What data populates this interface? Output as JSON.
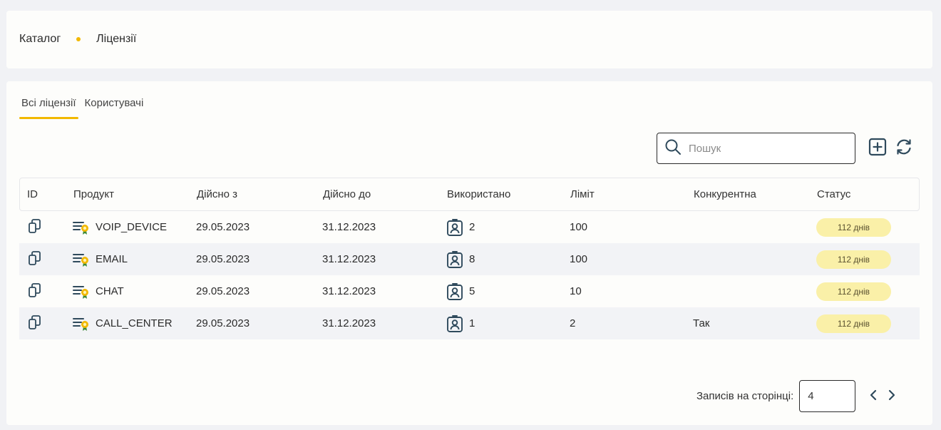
{
  "breadcrumb": {
    "root": "Каталог",
    "current": "Ліцензії"
  },
  "tabs": [
    {
      "label": "Всі ліцензії",
      "active": true
    },
    {
      "label": "Користувачі",
      "active": false
    }
  ],
  "search": {
    "placeholder": "Пошук",
    "value": ""
  },
  "table": {
    "headers": {
      "id": "ID",
      "product": "Продукт",
      "valid_from": "Дійсно з",
      "valid_to": "Дійсно до",
      "used": "Використано",
      "limit": "Ліміт",
      "concurrent": "Конкурентна",
      "status": "Статус"
    },
    "rows": [
      {
        "product": "VOIP_DEVICE",
        "valid_from": "29.05.2023",
        "valid_to": "31.12.2023",
        "used": "2",
        "limit": "100",
        "concurrent": "",
        "status": "112 днів"
      },
      {
        "product": "EMAIL",
        "valid_from": "29.05.2023",
        "valid_to": "31.12.2023",
        "used": "8",
        "limit": "100",
        "concurrent": "",
        "status": "112 днів"
      },
      {
        "product": "CHAT",
        "valid_from": "29.05.2023",
        "valid_to": "31.12.2023",
        "used": "5",
        "limit": "10",
        "concurrent": "",
        "status": "112 днів"
      },
      {
        "product": "CALL_CENTER",
        "valid_from": "29.05.2023",
        "valid_to": "31.12.2023",
        "used": "1",
        "limit": "2",
        "concurrent": "Так",
        "status": "112 днів"
      }
    ]
  },
  "pager": {
    "label": "Записів на сторінці:",
    "value": "4"
  },
  "colors": {
    "accent": "#f2b800",
    "badge_bg": "#faf0a8",
    "icon": "#2f4a5c"
  },
  "icons": {
    "copy": "copy-icon",
    "product": "license-list-icon",
    "used": "user-badge-icon",
    "search": "search-icon",
    "add": "add-square-icon",
    "refresh": "refresh-icon",
    "prev": "chevron-left-icon",
    "next": "chevron-right-icon"
  }
}
